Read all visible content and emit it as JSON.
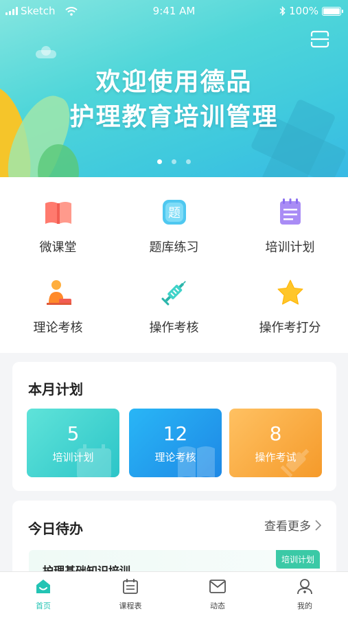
{
  "status_bar": {
    "carrier": "Sketch",
    "time": "9:41 AM",
    "battery": "100%"
  },
  "banner": {
    "title_line1": "欢迎使用德品",
    "title_line2": "护理教育培训管理",
    "slides": 3,
    "active_slide": 1
  },
  "menu": [
    {
      "label": "微课堂",
      "icon": "book-icon"
    },
    {
      "label": "题库练习",
      "icon": "question-bank-icon"
    },
    {
      "label": "培训计划",
      "icon": "notepad-icon"
    },
    {
      "label": "理论考核",
      "icon": "student-desk-icon"
    },
    {
      "label": "操作考核",
      "icon": "syringe-icon"
    },
    {
      "label": "操作考打分",
      "icon": "star-icon"
    }
  ],
  "monthly_plan": {
    "title": "本月计划",
    "tiles": [
      {
        "value": "5",
        "label": "培训计划",
        "color": "#2cc5c8"
      },
      {
        "value": "12",
        "label": "理论考核",
        "color": "#1e88e5"
      },
      {
        "value": "8",
        "label": "操作考试",
        "color": "#f59a2a"
      }
    ]
  },
  "todo": {
    "title": "今日待办",
    "more_label": "查看更多",
    "items": [
      {
        "name": "护理基础知识培训",
        "tag": "培训计划"
      }
    ]
  },
  "tabbar": [
    {
      "label": "首页",
      "icon": "home-icon",
      "active": true
    },
    {
      "label": "课程表",
      "icon": "calendar-icon",
      "active": false
    },
    {
      "label": "动态",
      "icon": "mail-icon",
      "active": false
    },
    {
      "label": "我的",
      "icon": "profile-icon",
      "active": false
    }
  ],
  "colors": {
    "accent": "#23c4b4",
    "banner": "#3ec8de"
  }
}
